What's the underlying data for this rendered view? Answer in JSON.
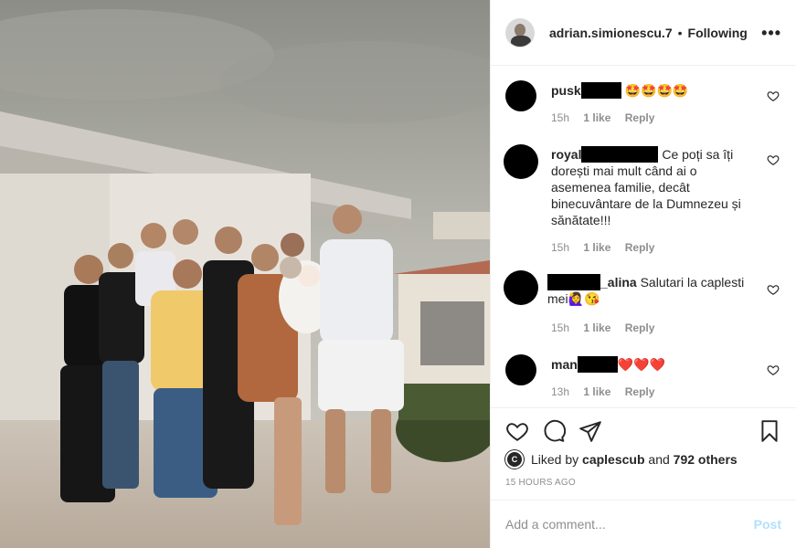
{
  "header": {
    "username": "adrian.simionescu.7",
    "separator": "•",
    "follow_status": "Following",
    "more_label": "•••"
  },
  "comments": [
    {
      "user": "pusk",
      "text": "",
      "emoji": "🤩🤩🤩🤩",
      "time": "15h",
      "likes": "1 like",
      "reply": "Reply"
    },
    {
      "user": "royal",
      "text": "Ce poți sa îți dorești mai mult când ai o asemenea familie, decât binecuvântare de la Dumnezeu și sănătate!!!",
      "emoji": "",
      "time": "15h",
      "likes": "1 like",
      "reply": "Reply"
    },
    {
      "user": "_alina",
      "text": "Salutari la caplesti mei",
      "emoji": "🙋‍♀️😘",
      "time": "15h",
      "likes": "1 like",
      "reply": "Reply"
    },
    {
      "user": "man",
      "text": "",
      "emoji": "❤️❤️❤️",
      "time": "13h",
      "likes": "1 like",
      "reply": "Reply"
    }
  ],
  "likes": {
    "prefix": "Liked by",
    "user": "caplescub",
    "joiner": "and",
    "others": "792 others"
  },
  "timestamp": "15 HOURS AGO",
  "composer": {
    "placeholder": "Add a comment...",
    "post_label": "Post"
  },
  "colors": {
    "accent_disabled": "#b2dffc",
    "muted": "#8e8e8e",
    "text": "#262626",
    "border": "#efefef"
  },
  "icons": [
    "heart-icon",
    "comment-icon",
    "share-icon",
    "bookmark-icon",
    "more-icon"
  ]
}
